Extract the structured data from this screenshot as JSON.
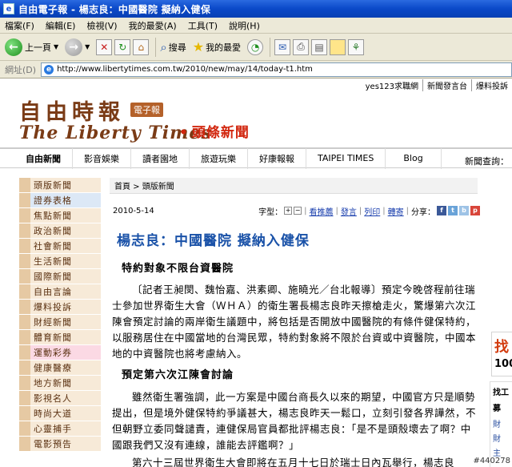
{
  "window": {
    "title": "自由電子報 - 楊志良：中國醫院 擬納入健保"
  },
  "menu": [
    "檔案(F)",
    "編輯(E)",
    "檢視(V)",
    "我的最愛(A)",
    "工具(T)",
    "說明(H)"
  ],
  "toolbar": {
    "back": "上一頁",
    "search": "搜尋",
    "favorites": "我的最愛"
  },
  "address": {
    "label": "網址(D)",
    "url": "http://www.libertytimes.com.tw/2010/new/may/14/today-t1.htm"
  },
  "top_links": [
    "yes123求職網",
    "新聞發言台",
    "爆料投訴"
  ],
  "logo": {
    "zh": "自由時報",
    "badge": "電子報",
    "en": "The Liberty Times",
    "section": "頭條新聞",
    "dot": "•"
  },
  "nav": {
    "items": [
      "自由新聞",
      "影音娛樂",
      "讀者園地",
      "旅遊玩樂",
      "好康報報",
      "TAIPEI TIMES",
      "Blog"
    ],
    "query": "新聞查詢："
  },
  "sidebar": [
    "頭版新聞",
    "證券表格",
    "焦點新聞",
    "政治新聞",
    "社會新聞",
    "生活新聞",
    "國際新聞",
    "自由言論",
    "爆料投訴",
    "財經新聞",
    "體育新聞",
    "運動彩券",
    "健康醫療",
    "地方新聞",
    "影視名人",
    "時尚大道",
    "心靈捕手",
    "電影預告"
  ],
  "breadcrumb": "首頁 > 頭版新聞",
  "meta": {
    "date": "2010-5-14",
    "font_size": "字型：",
    "plus": "+",
    "minus": "−",
    "recommend": "看推薦",
    "comment": "發言",
    "print": "列印",
    "forward": "轉寄",
    "share": "分享："
  },
  "article": {
    "headline": "楊志良：中國醫院 擬納入健保",
    "subhead1": "特約對象不限台資醫院",
    "para1": "〔記者王昶閔、魏怡嘉、洪素卿、施曉光／台北報導〕預定今晚啓程前往瑞士參加世界衛生大會（ＷＨＡ）的衛生署長楊志良昨天擦槍走火，驚爆第六次江陳會預定討論的兩岸衛生議題中，將包括是否開放中國醫院的有條件健保特約，以服務居住在中國當地的台灣民眾，特約對象將不限於台資或中資醫院，中國本地的中資醫院也將考慮納入。",
    "subhead2": "預定第六次江陳會討論",
    "para2": "雖然衛生署強調，此一方案是中國台商長久以來的期望，中國官方只是順勢提出，但是境外健保特約爭議甚大，楊志良昨天一鬆口，立刻引發各界譁然，不但朝野立委同聲譴責，連健保局官員都批評楊志良：「是不是頭殼壞去了啊？中國跟我們又沒有連線，誰能去評鑑啊？」",
    "para3": "第六十三屆世界衛生大會即將在五月十七日於瑞士日內瓦舉行，楊志良"
  },
  "right_ad": {
    "t1": "找",
    "t2": "100"
  },
  "right_col": {
    "h": "找工",
    "h2": "募",
    "links": [
      "財",
      "財",
      "主"
    ]
  },
  "watermark": "#440278"
}
